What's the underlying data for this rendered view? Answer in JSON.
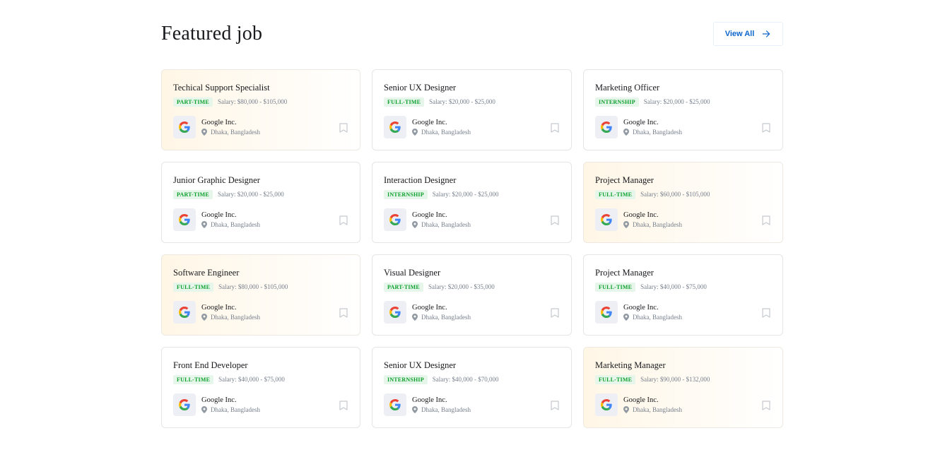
{
  "section": {
    "title": "Featured job",
    "view_all_label": "View All"
  },
  "jobs": [
    {
      "title": "Techical Support Specialist",
      "type": "PART-TIME",
      "salary": "Salary: $80,000 - $105,000",
      "company": "Google Inc.",
      "location": "Dhaka, Bangladesh",
      "featured": true
    },
    {
      "title": "Senior UX Designer",
      "type": "FULL-TIME",
      "salary": "Salary: $20,000 - $25,000",
      "company": "Google Inc.",
      "location": "Dhaka, Bangladesh",
      "featured": false
    },
    {
      "title": "Marketing Officer",
      "type": "INTERNSHIP",
      "salary": "Salary: $20,000 - $25,000",
      "company": "Google Inc.",
      "location": "Dhaka, Bangladesh",
      "featured": false
    },
    {
      "title": "Junior Graphic Designer",
      "type": "PART-TIME",
      "salary": "Salary: $20,000 - $25,000",
      "company": "Google Inc.",
      "location": "Dhaka, Bangladesh",
      "featured": false
    },
    {
      "title": "Interaction Designer",
      "type": "INTERNSHIP",
      "salary": "Salary: $20,000 - $25,000",
      "company": "Google Inc.",
      "location": "Dhaka, Bangladesh",
      "featured": false
    },
    {
      "title": "Project Manager",
      "type": "FULL-TIME",
      "salary": "Salary: $60,000 - $105,000",
      "company": "Google Inc.",
      "location": "Dhaka, Bangladesh",
      "featured": true
    },
    {
      "title": "Software Engineer",
      "type": "FULL-TIME",
      "salary": "Salary: $80,000 - $105,000",
      "company": "Google Inc.",
      "location": "Dhaka, Bangladesh",
      "featured": true
    },
    {
      "title": "Visual Designer",
      "type": "PART-TIME",
      "salary": "Salary: $20,000 - $35,000",
      "company": "Google Inc.",
      "location": "Dhaka, Bangladesh",
      "featured": false
    },
    {
      "title": "Project Manager",
      "type": "FULL-TIME",
      "salary": "Salary: $40,000 - $75,000",
      "company": "Google Inc.",
      "location": "Dhaka, Bangladesh",
      "featured": false
    },
    {
      "title": "Front End Developer",
      "type": "FULL-TIME",
      "salary": "Salary: $40,000 - $75,000",
      "company": "Google Inc.",
      "location": "Dhaka, Bangladesh",
      "featured": false
    },
    {
      "title": "Senior UX Designer",
      "type": "INTERNSHIP",
      "salary": "Salary: $40,000 - $70,000",
      "company": "Google Inc.",
      "location": "Dhaka, Bangladesh",
      "featured": false
    },
    {
      "title": "Marketing Manager",
      "type": "FULL-TIME",
      "salary": "Salary: $90,000 - $132,000",
      "company": "Google Inc.",
      "location": "Dhaka, Bangladesh",
      "featured": true
    }
  ],
  "icons": {
    "company_logo": "google-logo-icon",
    "location": "map-pin-icon",
    "bookmark": "bookmark-icon",
    "arrow": "arrow-right-icon"
  },
  "colors": {
    "accent": "#0a65cc",
    "job_type_text": "#0ba02c",
    "job_type_bg": "#e7f6ea",
    "featured_bg": "#fff6e6"
  }
}
